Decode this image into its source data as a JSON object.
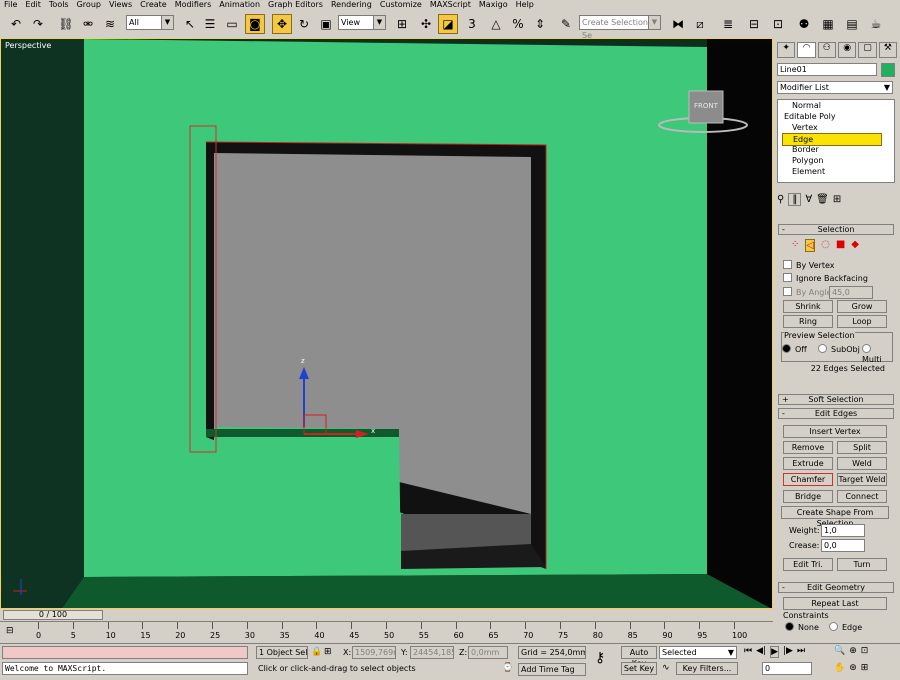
{
  "menu": [
    "File",
    "Edit",
    "Tools",
    "Group",
    "Views",
    "Create",
    "Modifiers",
    "Animation",
    "Graph Editors",
    "Rendering",
    "Customize",
    "MAXScript",
    "Maxigo",
    "Help"
  ],
  "toolbar": {
    "filter_value": "All",
    "refcoord_value": "View",
    "named_selection_placeholder": "Create Selection Se"
  },
  "viewport": {
    "label": "Perspective",
    "viewcube_label": "FRONT",
    "axis_x": "x",
    "axis_z": "z"
  },
  "panel": {
    "object_name": "Line01",
    "object_color": "#1fb060",
    "modifier_list": "Modifier List",
    "stack": [
      "Normal",
      "Editable Poly",
      "Vertex",
      "Edge",
      "Border",
      "Polygon",
      "Element"
    ],
    "selection": {
      "title": "Selection",
      "by_vertex": "By Vertex",
      "ignore_backfacing": "Ignore Backfacing",
      "by_angle": "By Angle:",
      "angle_value": "45,0",
      "shrink": "Shrink",
      "grow": "Grow",
      "ring": "Ring",
      "loop": "Loop",
      "preview_title": "Preview Selection",
      "preview_off": "Off",
      "preview_subobj": "SubObj",
      "preview_multi": "Multi",
      "status": "22 Edges Selected"
    },
    "soft_selection": "Soft Selection",
    "edit_edges": {
      "title": "Edit Edges",
      "insert_vertex": "Insert Vertex",
      "remove": "Remove",
      "split": "Split",
      "extrude": "Extrude",
      "weld": "Weld",
      "chamfer": "Chamfer",
      "target_weld": "Target Weld",
      "bridge": "Bridge",
      "connect": "Connect",
      "create_shape": "Create Shape From Selection",
      "weight_label": "Weight:",
      "weight_value": "1,0",
      "crease_label": "Crease:",
      "crease_value": "0,0",
      "edit_tri": "Edit Tri.",
      "turn": "Turn"
    },
    "edit_geometry": {
      "title": "Edit Geometry",
      "repeat_last": "Repeat Last",
      "constraints": "Constraints",
      "none": "None",
      "edge": "Edge"
    }
  },
  "timeline": {
    "frame": "0 / 100",
    "ticks": [
      "0",
      "5",
      "10",
      "15",
      "20",
      "25",
      "30",
      "35",
      "40",
      "45",
      "50",
      "55",
      "60",
      "65",
      "70",
      "75",
      "80",
      "85",
      "90",
      "95",
      "100"
    ]
  },
  "status": {
    "maxscript": "Welcome to MAXScript.",
    "selected": "1 Object Sele",
    "x_label": "X:",
    "x_value": "1509,769n",
    "y_label": "Y:",
    "y_value": "24454,185",
    "z_label": "Z:",
    "z_value": "0,0mm",
    "grid": "Grid = 254,0mm",
    "prompt": "Click or click-and-drag to select objects",
    "add_time_tag": "Add Time Tag",
    "auto_key": "Auto Key",
    "set_key": "Set Key",
    "selected_filter": "Selected",
    "key_filters": "Key Filters...",
    "frame_value": "0"
  }
}
